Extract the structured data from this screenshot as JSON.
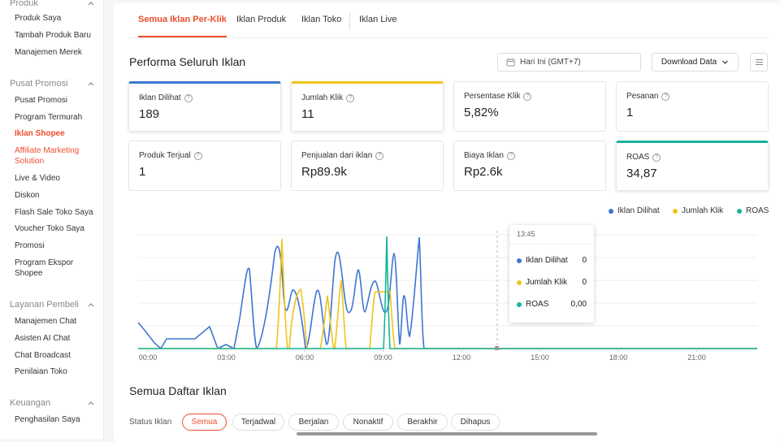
{
  "sidebar": {
    "sections": [
      {
        "title": "Produk",
        "items": [
          "Produk Saya",
          "Tambah Produk Baru",
          "Manajemen Merek"
        ]
      },
      {
        "title": "Pusat Promosi",
        "items": [
          "Pusat Promosi",
          "Program Termurah",
          "Iklan Shopee",
          "Affiliate Marketing Solution",
          "Live & Video",
          "Diskon",
          "Flash Sale Toko Saya",
          "Voucher Toko Saya",
          "Promosi",
          "Program Ekspor Shopee"
        ]
      },
      {
        "title": "Layanan Pembeli",
        "items": [
          "Manajemen Chat",
          "Asisten AI Chat",
          "Chat Broadcast",
          "Penilaian Toko"
        ]
      },
      {
        "title": "Keuangan",
        "items": [
          "Penghasilan Saya"
        ]
      }
    ]
  },
  "tabs": [
    "Semua Iklan Per-Klik",
    "Iklan Produk",
    "Iklan Toko",
    "Iklan Live"
  ],
  "header": {
    "title": "Performa Seluruh Iklan",
    "date_label": "Hari Ini (GMT+7)",
    "download_label": "Download Data"
  },
  "metrics": [
    {
      "label": "Iklan Dilihat",
      "value": "189"
    },
    {
      "label": "Jumlah Klik",
      "value": "11"
    },
    {
      "label": "Persentase Klik",
      "value": "5,82%"
    },
    {
      "label": "Pesanan",
      "value": "1"
    },
    {
      "label": "Produk Terjual",
      "value": "1"
    },
    {
      "label": "Penjualan dari iklan",
      "value": "Rp89.9k"
    },
    {
      "label": "Biaya Iklan",
      "value": "Rp2.6k"
    },
    {
      "label": "ROAS",
      "value": "34,87"
    }
  ],
  "colors": {
    "accent": "#ee4d2d",
    "blue": "#3e76d1",
    "yellow": "#f0c419",
    "teal": "#17b49a"
  },
  "chart_data": {
    "type": "line",
    "x_ticks": [
      "00:00",
      "03:00",
      "06:00",
      "09:00",
      "12:00",
      "15:00",
      "18:00",
      "21:00"
    ],
    "legend_position": "top-right",
    "grid": true,
    "series": [
      {
        "name": "Iklan Dilihat",
        "color": "#3e76d1"
      },
      {
        "name": "Jumlah Klik",
        "color": "#f0c419"
      },
      {
        "name": "ROAS",
        "color": "#17b49a"
      }
    ],
    "tooltip": {
      "time": "13:45",
      "rows": [
        {
          "name": "Iklan Dilihat",
          "value": "0"
        },
        {
          "name": "Jumlah Klik",
          "value": "0"
        },
        {
          "name": "ROAS",
          "value": "0,00"
        }
      ]
    }
  },
  "list": {
    "title": "Semua Daftar Iklan",
    "status_label": "Status Iklan",
    "statuses": [
      "Semua",
      "Terjadwal",
      "Berjalan",
      "Nonaktif",
      "Berakhir",
      "Dihapus"
    ]
  }
}
